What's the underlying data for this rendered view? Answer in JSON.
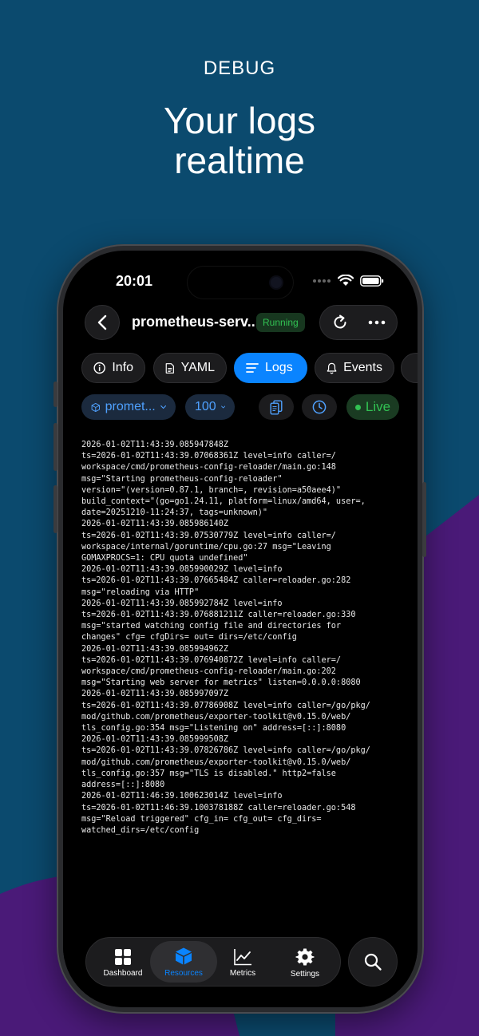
{
  "promo": {
    "eyebrow": "DEBUG",
    "headline_line1": "Your logs",
    "headline_line2": "realtime"
  },
  "colors": {
    "background": "#0b4a6e",
    "purple_shape": "#4a1a78",
    "accent": "#0a84ff",
    "running": "#32c253"
  },
  "status_bar": {
    "time": "20:01"
  },
  "header": {
    "title": "prometheus-serv...",
    "status_badge": "Running"
  },
  "tabs": [
    {
      "label": "Info",
      "icon": "info-circle-icon"
    },
    {
      "label": "YAML",
      "icon": "document-icon"
    },
    {
      "label": "Logs",
      "icon": "lines-icon",
      "active": true
    },
    {
      "label": "Events",
      "icon": "bell-icon"
    }
  ],
  "filters": {
    "container": "promet...",
    "line_count": "100",
    "live_label": "Live"
  },
  "log_lines": [
    "2026-01-02T11:43:39.085947848Z",
    "ts=2026-01-02T11:43:39.07068361Z level=info caller=/",
    "workspace/cmd/prometheus-config-reloader/main.go:148",
    "msg=\"Starting prometheus-config-reloader\"",
    "version=\"(version=0.87.1, branch=, revision=a50aee4)\"",
    "build_context=\"(go=go1.24.11, platform=linux/amd64, user=,",
    "date=20251210-11:24:37, tags=unknown)\"",
    "2026-01-02T11:43:39.085986140Z",
    "ts=2026-01-02T11:43:39.07530779Z level=info caller=/",
    "workspace/internal/goruntime/cpu.go:27 msg=\"Leaving",
    "GOMAXPROCS=1: CPU quota undefined\"",
    "2026-01-02T11:43:39.085990029Z level=info",
    "ts=2026-01-02T11:43:39.07665484Z caller=reloader.go:282",
    "msg=\"reloading via HTTP\"",
    "2026-01-02T11:43:39.085992784Z level=info",
    "ts=2026-01-02T11:43:39.076881211Z caller=reloader.go:330",
    "msg=\"started watching config file and directories for",
    "changes\" cfg= cfgDirs= out= dirs=/etc/config",
    "2026-01-02T11:43:39.085994962Z",
    "ts=2026-01-02T11:43:39.076940872Z level=info caller=/",
    "workspace/cmd/prometheus-config-reloader/main.go:202",
    "msg=\"Starting web server for metrics\" listen=0.0.0.0:8080",
    "2026-01-02T11:43:39.085997097Z",
    "ts=2026-01-02T11:43:39.07786908Z level=info caller=/go/pkg/",
    "mod/github.com/prometheus/exporter-toolkit@v0.15.0/web/",
    "tls_config.go:354 msg=\"Listening on\" address=[::]:8080",
    "2026-01-02T11:43:39.085999508Z",
    "ts=2026-01-02T11:43:39.07826786Z level=info caller=/go/pkg/",
    "mod/github.com/prometheus/exporter-toolkit@v0.15.0/web/",
    "tls_config.go:357 msg=\"TLS is disabled.\" http2=false",
    "address=[::]:8080",
    "2026-01-02T11:46:39.100623014Z level=info",
    "ts=2026-01-02T11:46:39.100378188Z caller=reloader.go:548",
    "msg=\"Reload triggered\" cfg_in= cfg_out= cfg_dirs=",
    "watched_dirs=/etc/config"
  ],
  "tabbar": [
    {
      "label": "Dashboard",
      "icon": "grid-icon"
    },
    {
      "label": "Resources",
      "icon": "cube-icon",
      "active": true
    },
    {
      "label": "Metrics",
      "icon": "chart-icon"
    },
    {
      "label": "Settings",
      "icon": "gear-icon"
    }
  ]
}
